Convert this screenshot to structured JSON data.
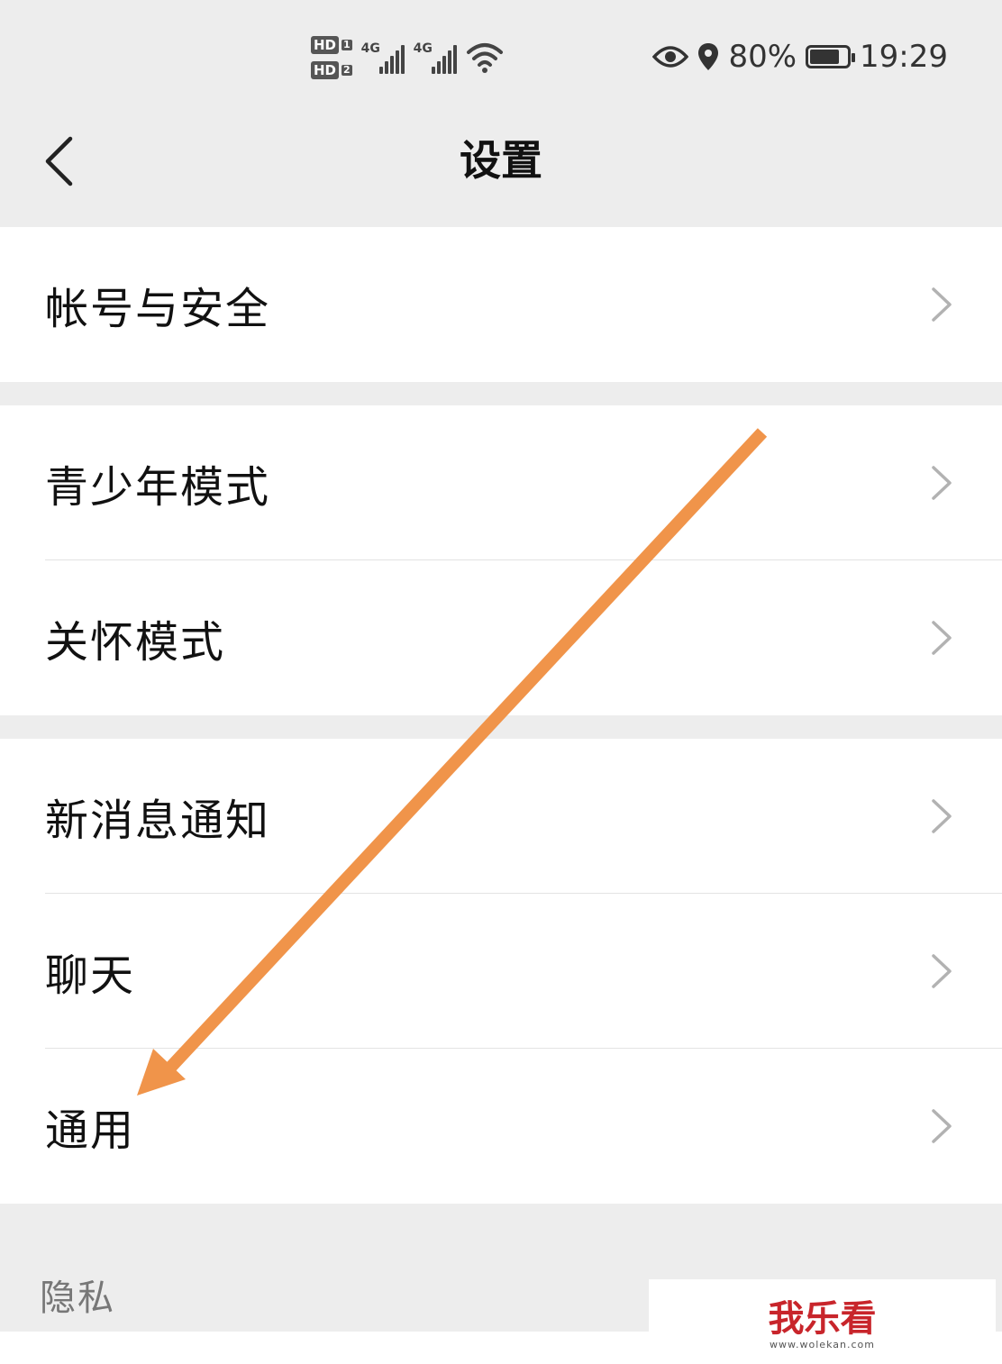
{
  "status_bar": {
    "hd1_label": "HD",
    "hd1_sim": "1",
    "hd2_label": "HD",
    "hd2_sim": "2",
    "signal1_tag": "4G",
    "signal2_tag": "4G",
    "battery_percent": "80%",
    "battery_level": 0.8,
    "time": "19:29"
  },
  "nav": {
    "title": "设置"
  },
  "groups": [
    {
      "items": [
        {
          "label": "帐号与安全"
        }
      ]
    },
    {
      "items": [
        {
          "label": "青少年模式"
        },
        {
          "label": "关怀模式"
        }
      ]
    },
    {
      "items": [
        {
          "label": "新消息通知"
        },
        {
          "label": "聊天"
        },
        {
          "label": "通用"
        }
      ]
    }
  ],
  "section": {
    "title": "隐私"
  },
  "watermark": {
    "text": "我乐看",
    "url": "www.wolekan.com"
  },
  "colors": {
    "arrow": "#f0944a",
    "background": "#ededed",
    "watermark": "#c8252b"
  }
}
